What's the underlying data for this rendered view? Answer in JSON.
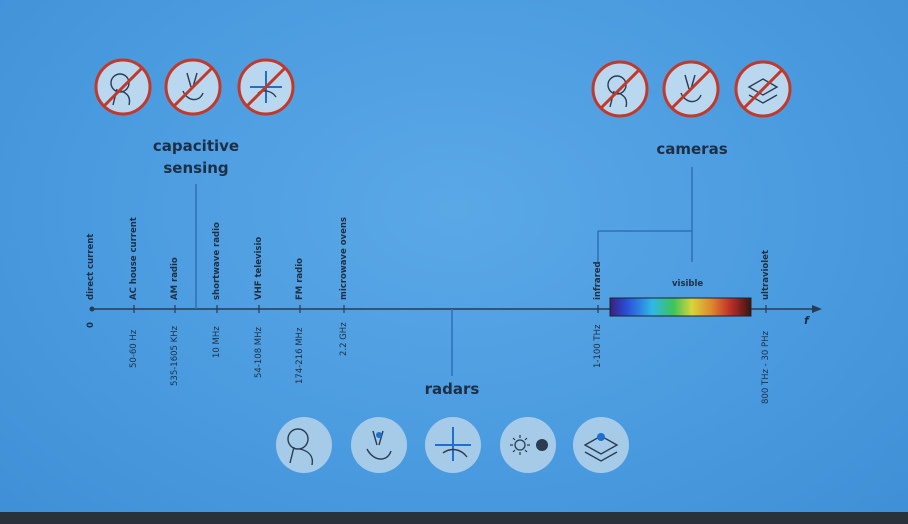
{
  "sections": {
    "capacitive": "capacitive\nsensing",
    "cameras": "cameras",
    "radars": "radars"
  },
  "axis": {
    "freq_symbol": "f",
    "origin_label": "0"
  },
  "spectrum": {
    "bands": [
      {
        "name": "direct current",
        "range": "0"
      },
      {
        "name": "AC house current",
        "range": "50-60 Hz"
      },
      {
        "name": "AM radio",
        "range": "535-1605 KHz"
      },
      {
        "name": "shortwave radio",
        "range": "10 MHz"
      },
      {
        "name": "VHF televisio",
        "range": "54-108 MHz"
      },
      {
        "name": "FM radio",
        "range": "174-216 MHz"
      },
      {
        "name": "microwave ovens",
        "range": "2.2 GHz"
      },
      {
        "name": "infrared",
        "range": "1-100 THz"
      },
      {
        "name": "ultraviolet",
        "range": "800 THz - 30 PHz"
      }
    ],
    "visible_label": "visible"
  },
  "icons": {
    "top_left": [
      "touch-crossed-icon",
      "pinch-crossed-icon",
      "swipe-crossed-icon"
    ],
    "top_right": [
      "touch-crossed-icon",
      "pinch-crossed-icon",
      "layers-crossed-icon"
    ],
    "bottom": [
      "touch-icon",
      "pinch-icon",
      "swipe-icon",
      "light-dot-icon",
      "layers-icon"
    ]
  },
  "colors": {
    "background": "#4b9be0",
    "axis": "#2a3b52",
    "prohibit_red": "#c0392b",
    "connector": "#2f6fb8"
  }
}
